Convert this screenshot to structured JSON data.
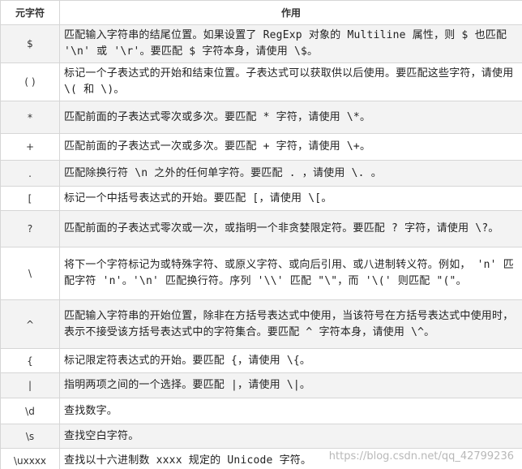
{
  "table": {
    "headers": [
      "元字符",
      "作用"
    ],
    "rows": [
      {
        "symbol": "$",
        "desc": "匹配输入字符串的结尾位置。如果设置了 RegExp 对象的 Multiline 属性，则 $ 也匹配 '\\n' 或 '\\r'。要匹配 $ 字符本身，请使用 \\$。"
      },
      {
        "symbol": "( )",
        "desc": "标记一个子表达式的开始和结束位置。子表达式可以获取供以后使用。要匹配这些字符，请使用 \\( 和 \\)。"
      },
      {
        "symbol": "*",
        "desc": "匹配前面的子表达式零次或多次。要匹配 * 字符，请使用 \\*。"
      },
      {
        "symbol": "+",
        "desc": "匹配前面的子表达式一次或多次。要匹配 + 字符，请使用 \\+。"
      },
      {
        "symbol": ".",
        "desc": "匹配除换行符 \\n 之外的任何单字符。要匹配 . ，请使用 \\. 。"
      },
      {
        "symbol": "[",
        "desc": "标记一个中括号表达式的开始。要匹配 [，请使用 \\[。"
      },
      {
        "symbol": "?",
        "desc": "匹配前面的子表达式零次或一次，或指明一个非贪婪限定符。要匹配 ? 字符，请使用 \\?。"
      },
      {
        "symbol": "\\",
        "desc": "将下一个字符标记为或特殊字符、或原义字符、或向后引用、或八进制转义符。例如， 'n' 匹配字符 'n'。'\\n' 匹配换行符。序列 '\\\\' 匹配 \"\\\"，而 '\\(' 则匹配 \"(\"。"
      },
      {
        "symbol": "^",
        "desc": "匹配输入字符串的开始位置，除非在方括号表达式中使用，当该符号在方括号表达式中使用时，表示不接受该方括号表达式中的字符集合。要匹配 ^ 字符本身，请使用 \\^。"
      },
      {
        "symbol": "{",
        "desc": "标记限定符表达式的开始。要匹配 {，请使用 \\{。"
      },
      {
        "symbol": "|",
        "desc": "指明两项之间的一个选择。要匹配 |，请使用 \\|。"
      },
      {
        "symbol": "\\d",
        "desc": "查找数字。"
      },
      {
        "symbol": "\\s",
        "desc": "查找空白字符。"
      },
      {
        "symbol": "\\uxxxx",
        "desc": "查找以十六进制数 xxxx 规定的 Unicode 字符。"
      }
    ]
  },
  "watermark": "https://blog.csdn.net/qq_42799236"
}
